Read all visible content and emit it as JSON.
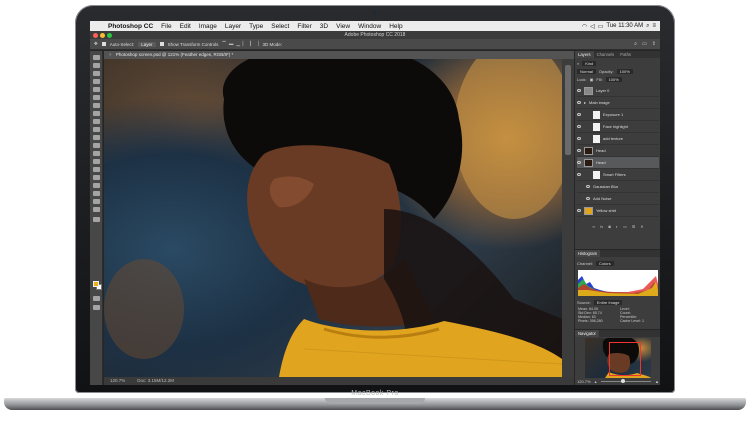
{
  "device": {
    "brand_label": "MacBook Pro"
  },
  "menubar": {
    "app_name": "Photoshop CC",
    "items": [
      "File",
      "Edit",
      "Image",
      "Layer",
      "Type",
      "Select",
      "Filter",
      "3D",
      "View",
      "Window",
      "Help"
    ],
    "status_icons": [
      "wifi-icon",
      "volume-icon",
      "battery-icon"
    ],
    "clock": "Tue 11:30 AM"
  },
  "window": {
    "title": "Adobe Photoshop CC 2018"
  },
  "options_bar": {
    "auto_select_label": "Auto-Select:",
    "auto_select_value": "Layer",
    "show_transform_label": "Show Transform Controls",
    "mode_label": "3D Mode:"
  },
  "document": {
    "tab_title": "Photoshop screen.psd @ 121% (Feather edges, RGB/8*) *",
    "zoom": "120.7%",
    "doc_info": "Doc: 3.15M/12.2M"
  },
  "layers_panel": {
    "tabs": [
      "Layers",
      "Channels",
      "Paths"
    ],
    "active_tab": "Layers",
    "filter_kind": "Kind",
    "blend_mode": "Normal",
    "opacity_label": "Opacity:",
    "opacity": "100%",
    "lock_label": "Lock:",
    "fill_label": "Fill:",
    "fill": "100%",
    "layers": [
      {
        "name": "Layer 0",
        "selected": false
      },
      {
        "name": "Main image",
        "selected": false
      },
      {
        "name": "Exposure 1",
        "selected": false
      },
      {
        "name": "Face highlight",
        "selected": false
      },
      {
        "name": "add texture",
        "selected": false
      },
      {
        "name": "Head",
        "selected": false
      },
      {
        "name": "Head",
        "selected": true
      },
      {
        "name": "Smart Filters",
        "selected": false
      },
      {
        "name": "Gaussian Blur",
        "selected": false
      },
      {
        "name": "Add Noise",
        "selected": false
      },
      {
        "name": "Yellow shirt",
        "selected": false
      }
    ]
  },
  "histogram": {
    "title": "Histogram",
    "channel_label": "Channel:",
    "channel": "Colors",
    "source_label": "Source:",
    "source": "Entire Image",
    "stats": [
      {
        "label": "Mean:",
        "value": "84.05"
      },
      {
        "label": "Level:",
        "value": ""
      },
      {
        "label": "Std Dev:",
        "value": "65.74"
      },
      {
        "label": "Count:",
        "value": ""
      },
      {
        "label": "Median:",
        "value": "63"
      },
      {
        "label": "Percentile:",
        "value": ""
      },
      {
        "label": "Pixels:",
        "value": "398,280"
      },
      {
        "label": "Cache Level:",
        "value": "1"
      }
    ]
  },
  "navigator": {
    "title": "Navigator",
    "zoom": "120.7%"
  },
  "colors": {
    "fg": "#e9b21c",
    "bg": "#ffffff",
    "shirt": "#e0a41f"
  }
}
